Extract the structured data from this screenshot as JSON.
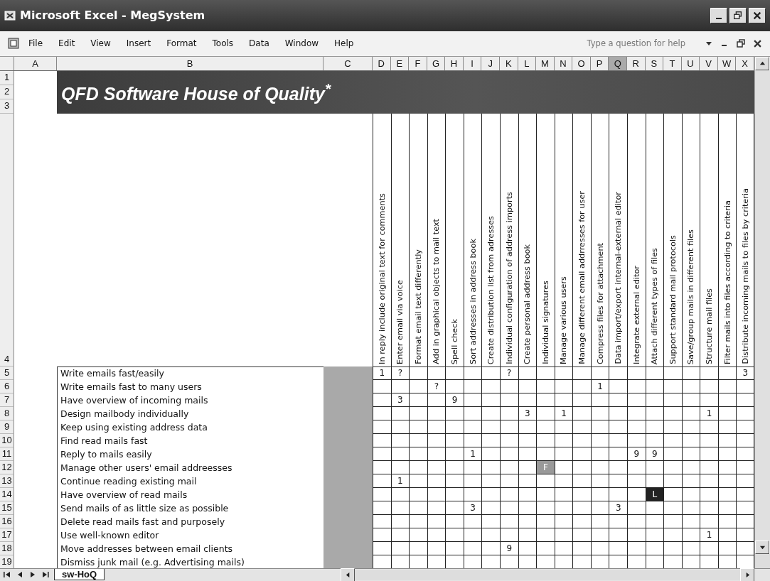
{
  "window": {
    "title": "Microsoft Excel - MegSystem"
  },
  "menu": [
    "File",
    "Edit",
    "View",
    "Insert",
    "Format",
    "Tools",
    "Data",
    "Window",
    "Help"
  ],
  "help_box": {
    "placeholder": "Type a question for help"
  },
  "columns": [
    {
      "label": "A",
      "selected": false
    },
    {
      "label": "B",
      "selected": false
    },
    {
      "label": "C",
      "selected": false
    },
    {
      "label": "D",
      "selected": false
    },
    {
      "label": "E",
      "selected": false
    },
    {
      "label": "F",
      "selected": false
    },
    {
      "label": "G",
      "selected": false
    },
    {
      "label": "H",
      "selected": false
    },
    {
      "label": "I",
      "selected": false
    },
    {
      "label": "J",
      "selected": false
    },
    {
      "label": "K",
      "selected": false
    },
    {
      "label": "L",
      "selected": false
    },
    {
      "label": "M",
      "selected": false
    },
    {
      "label": "N",
      "selected": false
    },
    {
      "label": "O",
      "selected": false
    },
    {
      "label": "P",
      "selected": false
    },
    {
      "label": "Q",
      "selected": true
    },
    {
      "label": "R",
      "selected": false
    },
    {
      "label": "S",
      "selected": false
    },
    {
      "label": "T",
      "selected": false
    },
    {
      "label": "U",
      "selected": false
    },
    {
      "label": "V",
      "selected": false
    },
    {
      "label": "W",
      "selected": false
    },
    {
      "label": "X",
      "selected": false
    }
  ],
  "banner": {
    "row_numbers": [
      "1",
      "2",
      "3"
    ],
    "title": "QFD Software House of Quality$^{*}$"
  },
  "header_row": {
    "number": "4",
    "headings": [
      "In reply include original text for comments",
      "Enter email via voice",
      "Format email text differently",
      "Add in graphical objects to mail text",
      "Spell check",
      "Sort addresses in address book",
      "Create distribution list from adresses",
      "Individual configuration of address imports",
      "Create personal address book",
      "Individual signatures",
      "Manage various users",
      "Manage different email addrresses for user",
      "Compress files for attachment",
      "Data import/export internal-external editor",
      "Integrate external editor",
      "Attach different types of files",
      "Support standard mail protocols",
      "Save/group mails in different files",
      "Structure mail files",
      "Filter mails into files according to criteria",
      "Distribute incoming mails to files by criteria"
    ]
  },
  "rows": [
    {
      "number": "5",
      "requirement": "Write emails fast/easily",
      "cells": [
        {
          "value": "1",
          "kind": "plain"
        },
        {
          "value": "?",
          "kind": "plain"
        },
        null,
        null,
        null,
        null,
        null,
        {
          "value": "?",
          "kind": "plain"
        },
        null,
        null,
        null,
        null,
        null,
        null,
        null,
        null,
        null,
        null,
        null,
        null,
        {
          "value": "3",
          "kind": "plain"
        }
      ]
    },
    {
      "number": "6",
      "requirement": "Write emails fast to many users",
      "cells": [
        null,
        null,
        null,
        {
          "value": "?",
          "kind": "plain"
        },
        null,
        null,
        null,
        null,
        null,
        null,
        null,
        null,
        {
          "value": "1",
          "kind": "plain"
        },
        null,
        null,
        null,
        null,
        null,
        null,
        null,
        null
      ]
    },
    {
      "number": "7",
      "requirement": "Have overview of incoming mails",
      "cells": [
        null,
        {
          "value": "3",
          "kind": "plain"
        },
        null,
        null,
        {
          "value": "9",
          "kind": "plain"
        },
        null,
        null,
        null,
        null,
        null,
        null,
        null,
        null,
        null,
        null,
        null,
        null,
        null,
        null,
        null,
        null
      ]
    },
    {
      "number": "8",
      "requirement": "Design mailbody individually",
      "cells": [
        null,
        null,
        null,
        null,
        null,
        null,
        null,
        null,
        {
          "value": "3",
          "kind": "plain"
        },
        null,
        {
          "value": "1",
          "kind": "plain"
        },
        null,
        null,
        null,
        null,
        null,
        null,
        null,
        {
          "value": "1",
          "kind": "plain"
        },
        null,
        null
      ]
    },
    {
      "number": "9",
      "requirement": "Keep using existing address data",
      "cells": [
        null,
        null,
        null,
        null,
        null,
        null,
        null,
        null,
        null,
        null,
        null,
        null,
        null,
        null,
        null,
        null,
        null,
        null,
        null,
        null,
        null
      ]
    },
    {
      "number": "10",
      "requirement": "Find read mails fast",
      "cells": [
        null,
        null,
        null,
        null,
        null,
        null,
        null,
        null,
        null,
        null,
        null,
        null,
        null,
        null,
        null,
        null,
        null,
        null,
        null,
        null,
        null
      ]
    },
    {
      "number": "11",
      "requirement": "Reply to mails easily",
      "cells": [
        null,
        null,
        null,
        null,
        null,
        {
          "value": "1",
          "kind": "plain"
        },
        null,
        null,
        null,
        null,
        null,
        null,
        null,
        null,
        {
          "value": "9",
          "kind": "plain"
        },
        {
          "value": "9",
          "kind": "plain"
        },
        null,
        null,
        null,
        null,
        null
      ]
    },
    {
      "number": "12",
      "requirement": "Manage other users' email addreesses",
      "cells": [
        null,
        null,
        null,
        null,
        null,
        null,
        null,
        null,
        null,
        {
          "value": "F",
          "kind": "grey"
        },
        null,
        null,
        null,
        null,
        null,
        null,
        null,
        null,
        null,
        null,
        null
      ]
    },
    {
      "number": "13",
      "requirement": "Continue reading existing mail",
      "cells": [
        null,
        {
          "value": "1",
          "kind": "plain"
        },
        null,
        null,
        null,
        null,
        null,
        null,
        null,
        null,
        null,
        null,
        null,
        null,
        null,
        null,
        null,
        null,
        null,
        null,
        null
      ]
    },
    {
      "number": "14",
      "requirement": "Have overview of read mails",
      "cells": [
        null,
        null,
        null,
        null,
        null,
        null,
        null,
        null,
        null,
        null,
        null,
        null,
        null,
        null,
        null,
        {
          "value": "L",
          "kind": "dark"
        },
        null,
        null,
        null,
        null,
        null
      ]
    },
    {
      "number": "15",
      "requirement": "Send mails of as little size as possible",
      "cells": [
        null,
        null,
        null,
        null,
        null,
        {
          "value": "3",
          "kind": "plain"
        },
        null,
        null,
        null,
        null,
        null,
        null,
        null,
        {
          "value": "3",
          "kind": "plain"
        },
        null,
        null,
        null,
        null,
        null,
        null,
        null
      ]
    },
    {
      "number": "16",
      "requirement": "Delete read mails fast and purposely",
      "cells": [
        null,
        null,
        null,
        null,
        null,
        null,
        null,
        null,
        null,
        null,
        null,
        null,
        null,
        null,
        null,
        null,
        null,
        null,
        null,
        null,
        null
      ]
    },
    {
      "number": "17",
      "requirement": "Use well-known editor",
      "cells": [
        null,
        null,
        null,
        null,
        null,
        null,
        null,
        null,
        null,
        null,
        null,
        null,
        null,
        null,
        null,
        null,
        null,
        null,
        {
          "value": "1",
          "kind": "plain"
        },
        null,
        null
      ]
    },
    {
      "number": "18",
      "requirement": "Move addresses between email clients",
      "cells": [
        null,
        null,
        null,
        null,
        null,
        null,
        null,
        {
          "value": "9",
          "kind": "plain"
        },
        null,
        null,
        null,
        null,
        null,
        null,
        null,
        null,
        null,
        null,
        null,
        null,
        null
      ]
    },
    {
      "number": "19",
      "requirement": "Dismiss junk mail (e.g. Advertising mails)",
      "cells": [
        null,
        null,
        null,
        null,
        null,
        null,
        null,
        null,
        null,
        null,
        null,
        null,
        null,
        null,
        null,
        null,
        null,
        null,
        null,
        null,
        null
      ]
    }
  ],
  "sheet_tabs": [
    {
      "label": "sw-HoQ",
      "selected": true
    }
  ]
}
